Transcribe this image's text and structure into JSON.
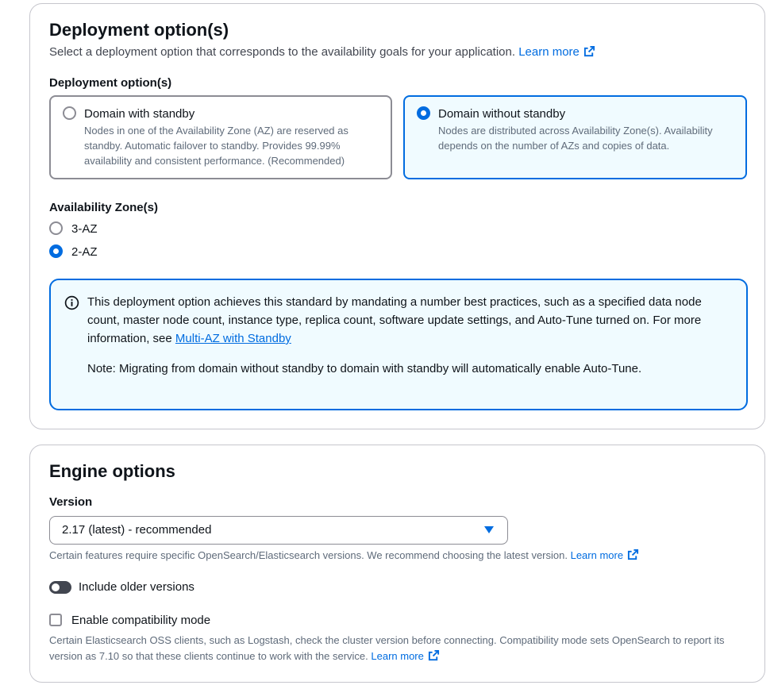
{
  "deployment": {
    "title": "Deployment option(s)",
    "description": "Select a deployment option that corresponds to the availability goals for your application.",
    "learn_more": "Learn more",
    "field_label": "Deployment option(s)",
    "options": [
      {
        "title": "Domain with standby",
        "text": "Nodes in one of the Availability Zone (AZ) are reserved as standby. Automatic failover to standby. Provides 99.99% availability and consistent performance. (Recommended)",
        "selected": false
      },
      {
        "title": "Domain without standby",
        "text": "Nodes are distributed across Availability Zone(s). Availability depends on the number of AZs and copies of data.",
        "selected": true
      }
    ],
    "az_label": "Availability Zone(s)",
    "az_options": [
      {
        "label": "3-AZ",
        "selected": false
      },
      {
        "label": "2-AZ",
        "selected": true
      }
    ],
    "info": {
      "text": "This deployment option achieves this standard by mandating a number best practices, such as a specified data node count, master node count, instance type, replica count, software update settings, and Auto-Tune turned on. For more information, see",
      "link": "Multi-AZ with Standby",
      "note": "Note: Migrating from domain without standby to domain with standby will automatically enable Auto-Tune."
    }
  },
  "engine": {
    "title": "Engine options",
    "version_label": "Version",
    "version_value": "2.17 (latest) - recommended",
    "version_hint": "Certain features require specific OpenSearch/Elasticsearch versions. We recommend choosing the latest version.",
    "learn_more": "Learn more",
    "toggle_label": "Include older versions",
    "toggle_on": false,
    "compat_label": "Enable compatibility mode",
    "compat_checked": false,
    "compat_hint": "Certain Elasticsearch OSS clients, such as Logstash, check the cluster version before connecting. Compatibility mode sets OpenSearch to report its version as 7.10 so that these clients continue to work with the service.",
    "compat_learn_more": "Learn more"
  },
  "colors": {
    "accent": "#006ce0",
    "selected_bg": "#f0fbff",
    "border": "#c6c6cd",
    "muted_text": "#5f6b7a"
  },
  "icons": [
    "external-link-icon",
    "info-icon",
    "caret-down-icon"
  ]
}
